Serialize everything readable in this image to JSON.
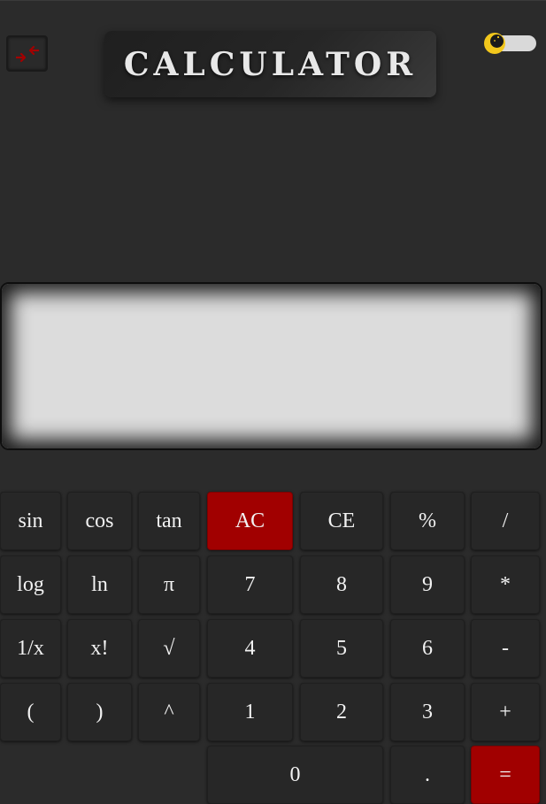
{
  "header": {
    "title": "CALCULATOR",
    "scientific_toggle_icon": "compress-arrows-icon",
    "theme_toggle_icon": "moon-icon"
  },
  "display": {
    "value": ""
  },
  "colors": {
    "background": "#2b2b2b",
    "button": "#272727",
    "accent_red": "#a10000",
    "display": "#dcdcdc",
    "moon": "#f2c71c"
  },
  "keypad": {
    "row1": [
      "sin",
      "cos",
      "tan",
      "AC",
      "CE",
      "%",
      "/"
    ],
    "row2": [
      "log",
      "ln",
      "π",
      "7",
      "8",
      "9",
      "*"
    ],
    "row3": [
      "1/x",
      "x!",
      "√",
      "4",
      "5",
      "6",
      "-"
    ],
    "row4": [
      "(",
      ")",
      "^",
      "1",
      "2",
      "3",
      "+"
    ],
    "row5": [
      "0",
      ".",
      "="
    ]
  }
}
